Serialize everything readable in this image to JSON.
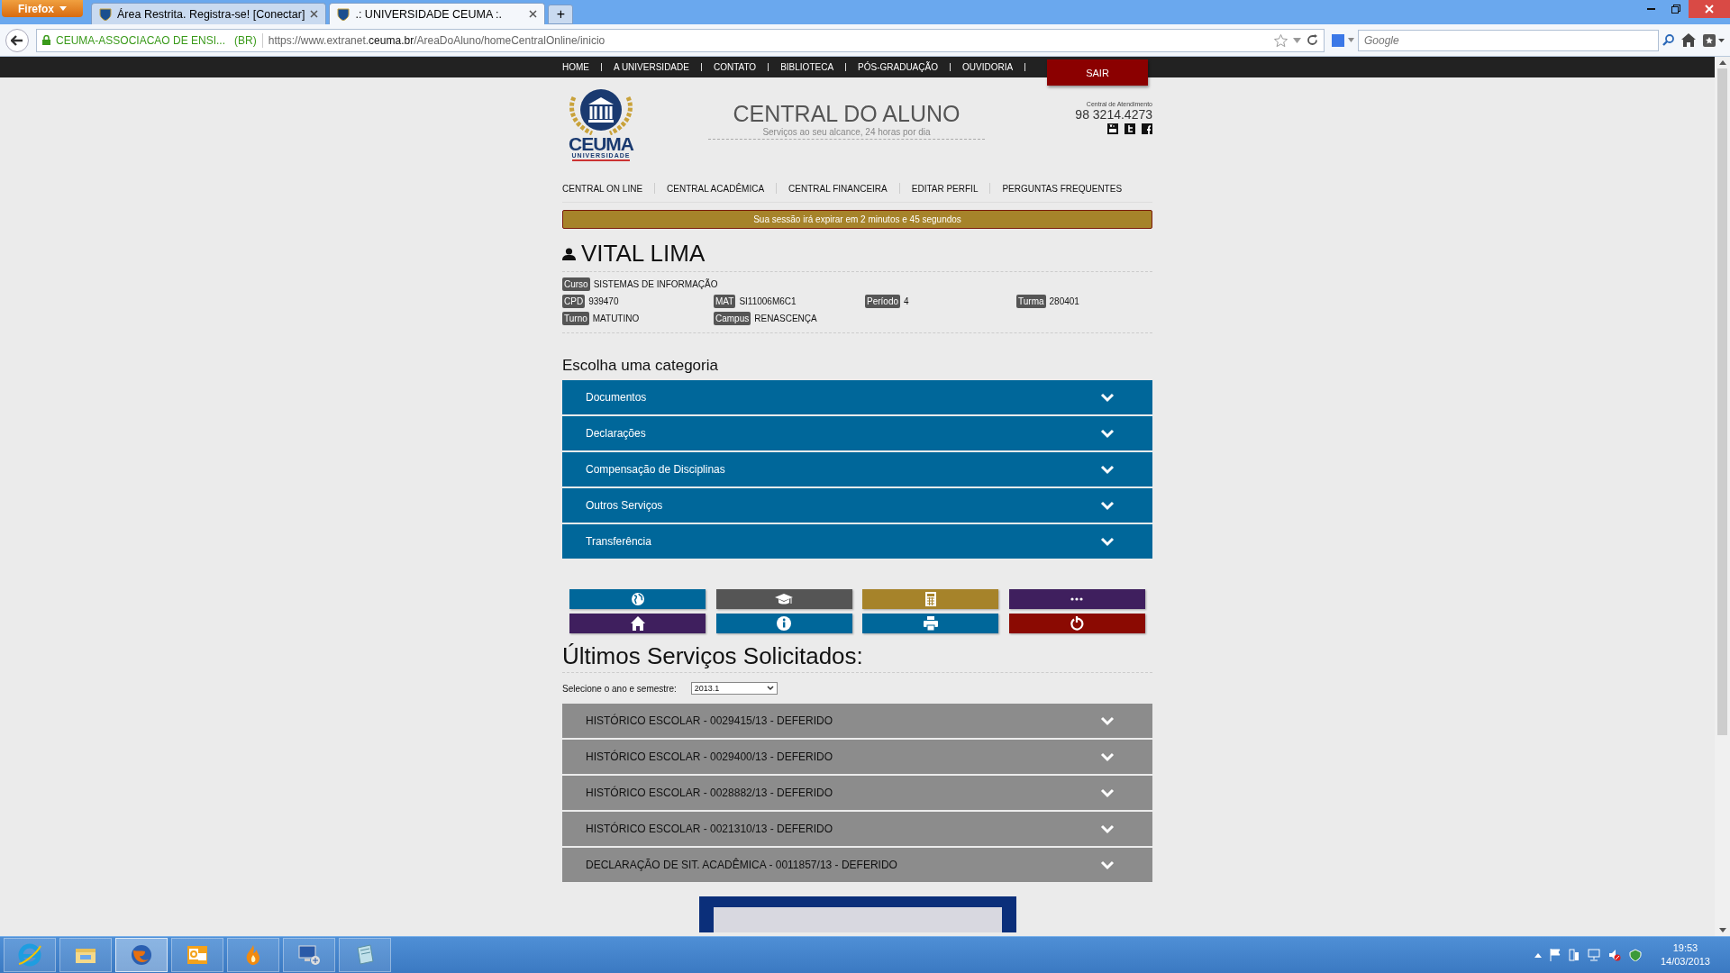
{
  "browser": {
    "menu_button": "Firefox",
    "tabs": [
      {
        "title": "Área Restrita. Registra-se! [Conectar]",
        "selected": false
      },
      {
        "title": ".: UNIVERSIDADE CEUMA :.",
        "selected": true
      }
    ],
    "new_tab": "+",
    "identity": "CEUMA-ASSOCIACAO DE ENSI...",
    "identity_country": "(BR)",
    "url": "https://www.extranet.**ceuma.br**/AreaDoAluno/homeCentralOnline/inicio",
    "search": {
      "placeholder": "Google"
    }
  },
  "site_nav": [
    "HOME",
    "A UNIVERSIDADE",
    "CONTATO",
    "BIBLIOTECA",
    "PÓS-GRADUAÇÃO",
    "OUVIDORIA"
  ],
  "exit_button": "SAIR",
  "header": {
    "logo_text": "CEUMA",
    "logo_subtext": "UNIVERSIDADE",
    "title": "CENTRAL DO ALUNO",
    "subtitle": "Serviços ao seu alcance, 24 horas por dia",
    "support_label": "Central de Atendimento",
    "phone": "98 3214.4273"
  },
  "main_nav": [
    "CENTRAL ON LINE",
    "CENTRAL ACADÊMICA",
    "CENTRAL FINANCEIRA",
    "EDITAR PERFIL",
    "PERGUNTAS FREQUENTES"
  ],
  "session_notice": "Sua sessão irá expirar em 2 minutos e 45 segundos",
  "student": {
    "name": "VITAL LIMA",
    "fields": [
      {
        "label": "Curso",
        "value": "SISTEMAS DE INFORMAÇÃO"
      },
      {
        "label": "CPD",
        "value": "939470"
      },
      {
        "label": "MAT",
        "value": "SI11006M6C1"
      },
      {
        "label": "Período",
        "value": "4"
      },
      {
        "label": "Turma",
        "value": "280401"
      },
      {
        "label": "Turno",
        "value": "MATUTINO"
      },
      {
        "label": "Campus",
        "value": "RENASCENÇA"
      }
    ]
  },
  "categories": {
    "title": "Escolha uma categoria",
    "items": [
      "Documentos",
      "Declarações",
      "Compensação de Disciplinas",
      "Outros Serviços",
      "Transferência"
    ]
  },
  "shortcuts": [
    {
      "kind": "globe",
      "color": "#00679a"
    },
    {
      "kind": "graduation-cap",
      "color": "#555555"
    },
    {
      "kind": "calculator",
      "color": "#a6832a"
    },
    {
      "kind": "more",
      "color": "#3f1f5e"
    },
    {
      "kind": "home",
      "color": "#3f1f5e"
    },
    {
      "kind": "info",
      "color": "#00679a"
    },
    {
      "kind": "printer",
      "color": "#00679a"
    },
    {
      "kind": "power",
      "color": "#8b0a02"
    }
  ],
  "services": {
    "title": "Últimos Serviços Solicitados:",
    "filter_label": "Selecione o ano e semestre:",
    "filter_value": "2013.1",
    "items": [
      "HISTÓRICO ESCOLAR - 0029415/13 - DEFERIDO",
      "HISTÓRICO ESCOLAR - 0029400/13 - DEFERIDO",
      "HISTÓRICO ESCOLAR - 0028882/13 - DEFERIDO",
      "HISTÓRICO ESCOLAR - 0021310/13 - DEFERIDO",
      "DECLARAÇÃO DE SIT. ACADÊMICA - 0011857/13 - DEFERIDO"
    ]
  },
  "taskbar": {
    "apps": [
      {
        "kind": "ie",
        "selected": false
      },
      {
        "kind": "folder",
        "selected": false
      },
      {
        "kind": "firefox",
        "selected": true
      },
      {
        "kind": "outlook",
        "selected": false
      },
      {
        "kind": "flame",
        "selected": false
      },
      {
        "kind": "remote",
        "selected": false
      },
      {
        "kind": "notebook",
        "selected": false
      }
    ],
    "time": "19:53",
    "date": "14/03/2013"
  }
}
